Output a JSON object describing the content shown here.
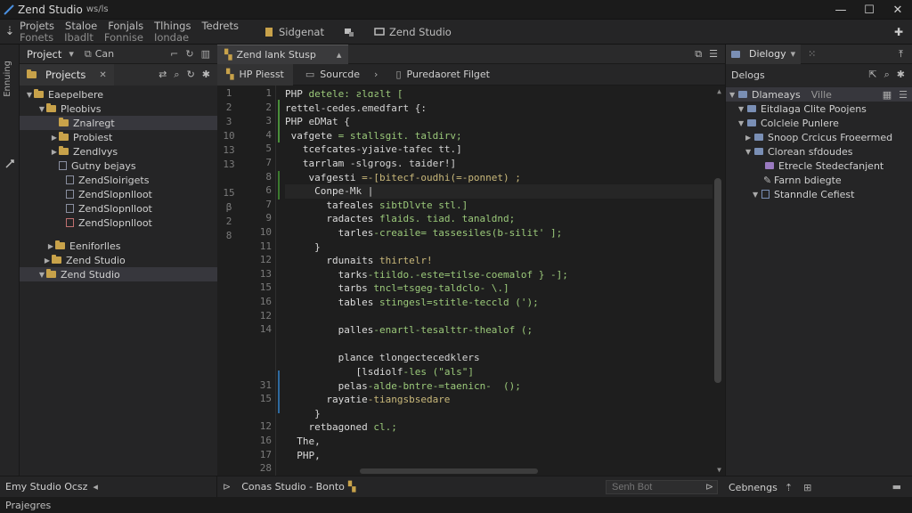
{
  "app": {
    "title": "Zend Studio",
    "title_suffix": "ws/ls",
    "window_controls": [
      "minimize-icon",
      "maximize-icon",
      "close-icon"
    ]
  },
  "menu": {
    "items": [
      "Projets",
      "Staloe",
      "Fonjals",
      "Tlhings",
      "Tedrets"
    ],
    "sub_items": [
      "Fonets",
      "Ibadlt",
      "Fonnise",
      "Iondae"
    ],
    "toolbar": [
      {
        "label": "Sidgenat",
        "icon": "bookmark-icon"
      },
      {
        "label": "",
        "icon": "build-icon"
      },
      {
        "label": "Zend Studio",
        "icon": "monitor-icon"
      }
    ]
  },
  "sidebar": {
    "vertical_label": "Ennuing",
    "header_label": "Project",
    "header_extra": "Can",
    "tab_label": "Projects",
    "tree": [
      {
        "label": "Eaepelbere",
        "level": 0,
        "expanded": true,
        "type": "folder"
      },
      {
        "label": "Pleobivs",
        "level": 1,
        "expanded": true,
        "type": "folder"
      },
      {
        "label": "Znalregt",
        "level": 2,
        "expanded": false,
        "type": "folder",
        "selected": true
      },
      {
        "label": "Probiest",
        "level": 2,
        "expanded": false,
        "type": "folder"
      },
      {
        "label": "Zendlvys",
        "level": 2,
        "expanded": false,
        "type": "folder"
      },
      {
        "label": "Gutny bejays",
        "level": 2,
        "expanded": false,
        "type": "file"
      },
      {
        "label": "ZendSloirigets",
        "level": 3,
        "expanded": false,
        "type": "file"
      },
      {
        "label": "ZendSlopnlloot",
        "level": 3,
        "expanded": false,
        "type": "file"
      },
      {
        "label": "ZendSlopnlloot",
        "level": 3,
        "expanded": false,
        "type": "file"
      },
      {
        "label": "ZendSlopnlloot",
        "level": 3,
        "expanded": false,
        "type": "file"
      },
      {
        "label": "Eeniforlles",
        "level": 1,
        "expanded": false,
        "type": "folder"
      },
      {
        "label": "Zend Studio",
        "level": 1,
        "expanded": false,
        "type": "folder"
      },
      {
        "label": "Zend Studio",
        "level": 1,
        "expanded": true,
        "type": "folder",
        "selected": true
      }
    ]
  },
  "editor": {
    "tabs": [
      {
        "label": "Zend lank Stusp",
        "active": true
      }
    ],
    "subtabs": [
      {
        "label": "HP Piesst",
        "active": true
      },
      {
        "label": "Sourcde",
        "active": false
      },
      {
        "label": "Puredaoret Filget",
        "active": false
      }
    ],
    "gutter_left": [
      "1",
      "2",
      "3",
      "10",
      "13",
      "13",
      "15",
      "β",
      "2",
      "8"
    ],
    "lines": [
      {
        "no": "1",
        "text": "PHP detele: ƨlɑƨlt ["
      },
      {
        "no": "2",
        "text": "rettel-cedes.emedfart {:"
      },
      {
        "no": "3",
        "text": "PHP eDMat {"
      },
      {
        "no": "4",
        "text": " vafgete = stallsgit. taldirv;"
      },
      {
        "no": "5",
        "text": "   tcefcates-yjaive-tafec tt.]"
      },
      {
        "no": "7",
        "text": "   tarrlam -slgrogs. taider!]"
      },
      {
        "no": "8",
        "text": "    vafgesti =-[bitecf-oudhi(=-ponnet) ;"
      },
      {
        "no": "6",
        "text": "     Conpe-Mk |"
      },
      {
        "no": "7",
        "text": "       tafeales sibtDlvte stl.]"
      },
      {
        "no": "9",
        "text": "       radactes flaids. tiad. tanaldnd;"
      },
      {
        "no": "10",
        "text": "         tarles-creaile= tassesiles(b-silit' ];"
      },
      {
        "no": "11",
        "text": "     }"
      },
      {
        "no": "12",
        "text": "       rdunaits thirtelr!"
      },
      {
        "no": "13",
        "text": "         tarks-tiildo.-este=tilse-coemalof } -];"
      },
      {
        "no": "15",
        "text": "         tarbs tncl=tsgeg-taldclo- \\.]"
      },
      {
        "no": "16",
        "text": "         tables stingesl=stitle-teccld (');"
      },
      {
        "no": "12",
        "text": ""
      },
      {
        "no": "14",
        "text": "         palles-enartl-tesalttr-thealof (;"
      },
      {
        "no": "",
        "text": ""
      },
      {
        "no": "",
        "text": "         plance tlongectecedklers"
      },
      {
        "no": "",
        "text": "            [lsdiolf-les (\"als\"]"
      },
      {
        "no": "31",
        "text": "         pelas-alde-bntre-=taenicn-  ();"
      },
      {
        "no": "15",
        "text": "       rayatie-tiangsbsedare"
      },
      {
        "no": "",
        "text": "     }"
      },
      {
        "no": "12",
        "text": "    retbagoned cl.;"
      },
      {
        "no": "16",
        "text": "  The,"
      },
      {
        "no": "17",
        "text": "  PHP,"
      },
      {
        "no": "28",
        "text": ""
      }
    ]
  },
  "right_panel": {
    "tab_label": "Dielogy",
    "sub_label": "Delogs",
    "tree": [
      {
        "label": "Dlameays",
        "extra": "Ville",
        "level": 0,
        "type": "bfolder",
        "selected": true
      },
      {
        "label": "Eitdlaga Clite Poojens",
        "level": 1,
        "type": "bfolder"
      },
      {
        "label": "Colcleie Punlere",
        "level": 1,
        "type": "bfolder"
      },
      {
        "label": "Snoop Crcicus Froeermed",
        "level": 1,
        "type": "bfolder"
      },
      {
        "label": "Clorean sfdoudes",
        "level": 1,
        "type": "bfolder"
      },
      {
        "label": "Etrecle Stedecfanjent",
        "level": 2,
        "type": "pfolder"
      },
      {
        "label": "Farnn bdiegte",
        "level": 2,
        "type": "pencil"
      },
      {
        "label": "Stanndle Cefiest",
        "level": 2,
        "type": "file"
      }
    ]
  },
  "bottom": {
    "left_label": "Emy Studio Ocsz",
    "mid_label": "Conas Studio - Bonto",
    "search_placeholder": "Senh Bot",
    "right_label": "Cebnengs"
  },
  "status": {
    "text": "Prajegres"
  }
}
